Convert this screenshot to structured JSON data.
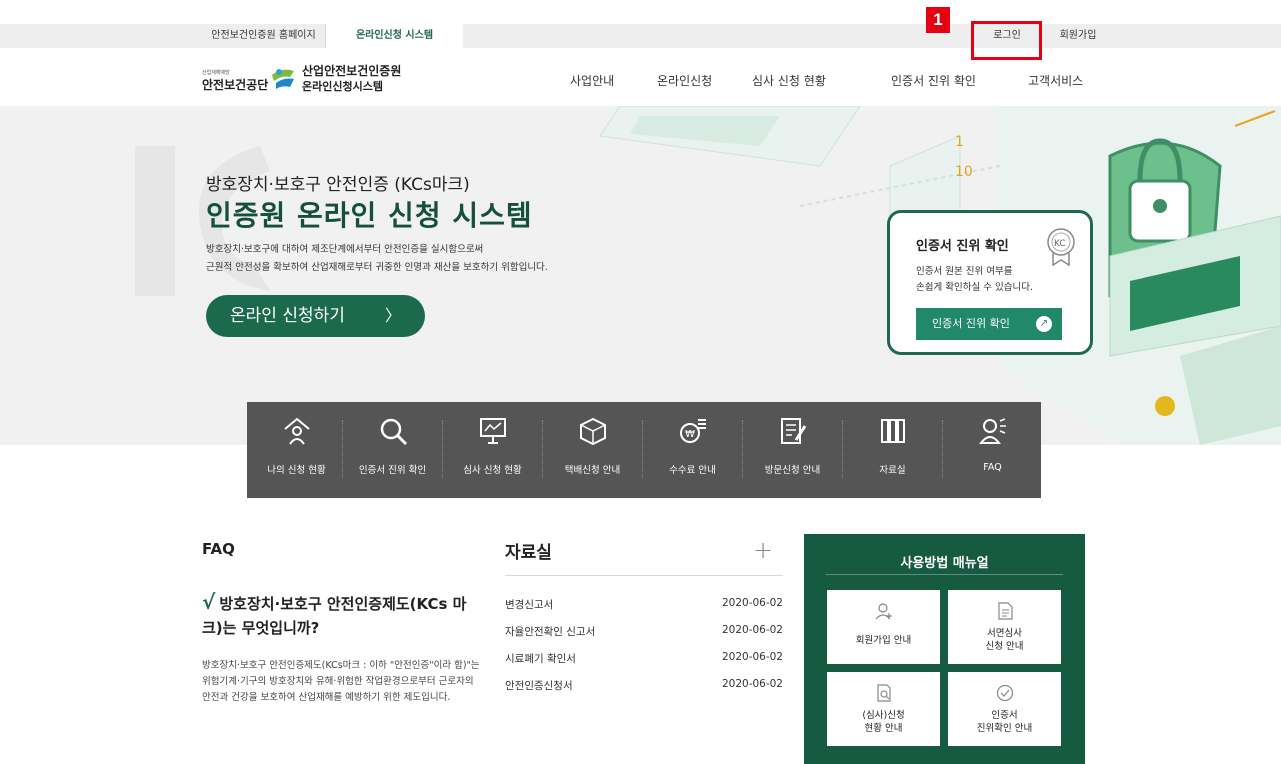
{
  "topbar": {
    "tab_home": "안전보건인증원 홈페이지",
    "tab_online": "온라인신청 시스템",
    "login": "로그인",
    "signup": "회원가입",
    "highlight_number": "1"
  },
  "header": {
    "org_small": "산업재해예방",
    "org": "안전보건공단",
    "title1": "산업안전보건인증원",
    "title2": "온라인신청시스템",
    "nav": [
      "사업안내",
      "온라인신청",
      "심사 신청 현황",
      "인증서 진위 확인",
      "고객서비스"
    ]
  },
  "hero": {
    "subtitle": "방호장치·보호구 안전인증 (KCs마크)",
    "title": "인증원 온라인 신청 시스템",
    "desc1": "방호장치·보호구에 대하여 제조단계에서부터 안전인증을 실시함으로써",
    "desc2": "근원적 안전성을 확보하여 산업재해로부터 귀중한 인명과 재산을 보호하기 위함입니다.",
    "button": "온라인 신청하기",
    "button_arrow": "〉"
  },
  "verify_card": {
    "title": "인증서 진위 확인",
    "desc1": "인증서 원본 진위 여부를",
    "desc2": "손쉽게 확인하실 수 있습니다.",
    "button": "인증서 진위 확인"
  },
  "quick_menu": [
    {
      "label": "나의 신청 현황",
      "icon": "home-person-icon"
    },
    {
      "label": "인증서 진위 확인",
      "icon": "search-icon"
    },
    {
      "label": "심사 신청 현황",
      "icon": "monitor-chart-icon"
    },
    {
      "label": "택배신청 안내",
      "icon": "box-icon"
    },
    {
      "label": "수수료 안내",
      "icon": "won-coin-icon"
    },
    {
      "label": "방문신청 안내",
      "icon": "document-pen-icon"
    },
    {
      "label": "자료실",
      "icon": "books-icon"
    },
    {
      "label": "FAQ",
      "icon": "faq-person-icon"
    }
  ],
  "faq": {
    "title": "FAQ",
    "question": "방호장치·보호구 안전인증제도(KCs 마크)는 무엇입니까?",
    "check": "√",
    "answer": "방호장치·보호구 안전인증제도(KCs마크 : 이하 \"안전인증\"이라 함)\"는 위험기계·기구의 방호장치와 유해·위험한 작업환경으로부터 근로자의 안전과 건강을 보호하여 산업재해를 예방하기 위한 제도입니다."
  },
  "library": {
    "title": "자료실",
    "plus": "+",
    "rows": [
      {
        "name": "변경신고서",
        "date": "2020-06-02"
      },
      {
        "name": "자율안전확인 신고서",
        "date": "2020-06-02"
      },
      {
        "name": "시료폐기 확인서",
        "date": "2020-06-02"
      },
      {
        "name": "안전인증신청서",
        "date": "2020-06-02"
      }
    ]
  },
  "manual": {
    "title": "사용방법 매뉴얼",
    "items": [
      {
        "line1": "회원가입 안내",
        "line2": "",
        "icon": "person-add-icon"
      },
      {
        "line1": "서면심사",
        "line2": "신청 안내",
        "icon": "document-icon"
      },
      {
        "line1": "(심사)신청",
        "line2": "현황 안내",
        "icon": "document-search-icon"
      },
      {
        "line1": "인증서",
        "line2": "진위확인 안내",
        "icon": "check-circle-icon"
      }
    ]
  },
  "colors": {
    "brand_green": "#1b6a4e",
    "dark_green": "#155a41",
    "highlight_red": "#e60012"
  }
}
